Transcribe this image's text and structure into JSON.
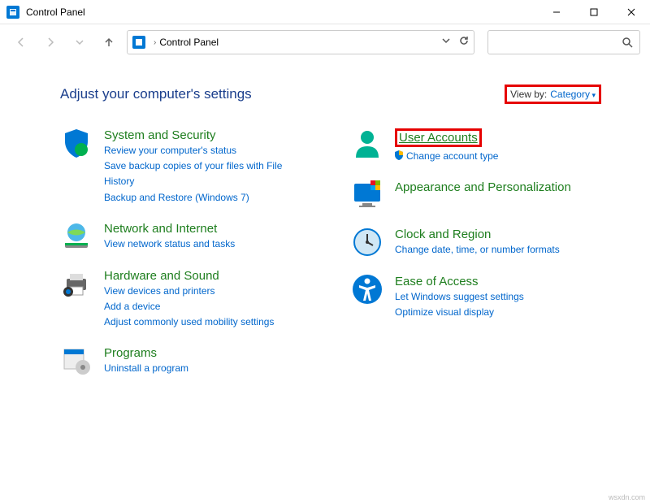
{
  "window": {
    "title": "Control Panel"
  },
  "breadcrumb": {
    "root": "Control Panel"
  },
  "heading": "Adjust your computer's settings",
  "viewBy": {
    "label": "View by:",
    "value": "Category"
  },
  "left": [
    {
      "title": "System and Security",
      "links": [
        "Review your computer's status",
        "Save backup copies of your files with File History",
        "Backup and Restore (Windows 7)"
      ]
    },
    {
      "title": "Network and Internet",
      "links": [
        "View network status and tasks"
      ]
    },
    {
      "title": "Hardware and Sound",
      "links": [
        "View devices and printers",
        "Add a device",
        "Adjust commonly used mobility settings"
      ]
    },
    {
      "title": "Programs",
      "links": [
        "Uninstall a program"
      ]
    }
  ],
  "right": [
    {
      "title": "User Accounts",
      "links": [
        "Change account type"
      ],
      "shield": true,
      "boxed": true
    },
    {
      "title": "Appearance and Personalization",
      "links": []
    },
    {
      "title": "Clock and Region",
      "links": [
        "Change date, time, or number formats"
      ]
    },
    {
      "title": "Ease of Access",
      "links": [
        "Let Windows suggest settings",
        "Optimize visual display"
      ]
    }
  ],
  "watermark": "wsxdn.com"
}
